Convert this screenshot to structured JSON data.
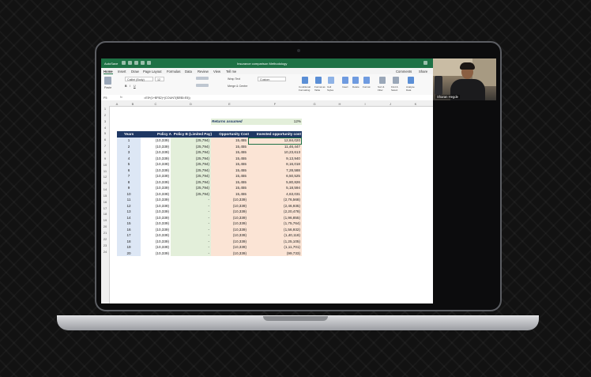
{
  "window": {
    "autosave": "AutoSave",
    "title": "Insurance comparison Methodology"
  },
  "menu": [
    "Home",
    "Insert",
    "Draw",
    "Page Layout",
    "Formulas",
    "Data",
    "Review",
    "View",
    "Tell me"
  ],
  "ribbon": {
    "font_name": "Calibri (Body)",
    "font_size": "12",
    "wrap_text": "Wrap Text",
    "merge_center": "Merge & Centre",
    "number_format": "Custom",
    "conditional_formatting": "Conditional Formatting",
    "format_as_table": "Format as Table",
    "cell_styles": "Cell Styles",
    "insert": "Insert",
    "delete": "Delete",
    "format": "Format",
    "sort_filter": "Sort & Filter",
    "find_select": "Find & Select",
    "analyse_data": "Analyse Data",
    "comments": "Comments",
    "share": "Share",
    "paste": "Paste"
  },
  "formula_bar": {
    "cell_ref": "F5",
    "formula": "=E5*(1+$F$2)^(COUNT($E$5:E5))"
  },
  "columns": [
    "A",
    "B",
    "C",
    "D",
    "E",
    "F",
    "G",
    "H",
    "I",
    "J",
    "K"
  ],
  "rows": [
    "1",
    "2",
    "3",
    "4",
    "5",
    "6",
    "7",
    "8",
    "9",
    "10",
    "11",
    "12",
    "13",
    "14",
    "15",
    "16",
    "17",
    "18",
    "19",
    "20",
    "21",
    "22",
    "23",
    "24"
  ],
  "sheet": {
    "returns_label": "Returns assumed",
    "returns_value": "12%",
    "headers": [
      "Years",
      "Policy A",
      "Policy B (Limited Pay)",
      "Opportunity Cost",
      "Invested opportunity cost"
    ],
    "table": [
      [
        "1",
        "(10,339)",
        "(25,794)",
        "15,455",
        "12,84,020"
      ],
      [
        "2",
        "(10,339)",
        "(25,794)",
        "15,455",
        "11,46,447"
      ],
      [
        "3",
        "(10,339)",
        "(25,794)",
        "15,455",
        "10,23,613"
      ],
      [
        "4",
        "(10,339)",
        "(25,794)",
        "15,455",
        "9,13,940"
      ],
      [
        "5",
        "(10,339)",
        "(25,794)",
        "15,455",
        "8,16,018"
      ],
      [
        "6",
        "(10,339)",
        "(25,794)",
        "15,455",
        "7,28,588"
      ],
      [
        "7",
        "(10,339)",
        "(25,794)",
        "15,455",
        "6,50,525"
      ],
      [
        "8",
        "(10,339)",
        "(25,794)",
        "15,455",
        "5,80,826"
      ],
      [
        "9",
        "(10,339)",
        "(25,794)",
        "15,455",
        "5,18,594"
      ],
      [
        "10",
        "(10,339)",
        "(25,794)",
        "15,455",
        "4,63,031"
      ],
      [
        "11",
        "(10,339)",
        "-",
        "(10,339)",
        "(2,76,568)"
      ],
      [
        "12",
        "(10,339)",
        "-",
        "(10,339)",
        "(2,46,935)"
      ],
      [
        "13",
        "(10,339)",
        "-",
        "(10,339)",
        "(2,20,478)"
      ],
      [
        "14",
        "(10,339)",
        "-",
        "(10,339)",
        "(1,96,855)"
      ],
      [
        "15",
        "(10,339)",
        "-",
        "(10,339)",
        "(1,75,764)"
      ],
      [
        "16",
        "(10,339)",
        "-",
        "(10,339)",
        "(1,56,932)"
      ],
      [
        "17",
        "(10,339)",
        "-",
        "(10,339)",
        "(1,40,118)"
      ],
      [
        "18",
        "(10,339)",
        "-",
        "(10,339)",
        "(1,25,105)"
      ],
      [
        "19",
        "(10,339)",
        "-",
        "(10,339)",
        "(1,11,701)"
      ],
      [
        "20",
        "(10,339)",
        "-",
        "(10,339)",
        "(99,733)"
      ]
    ]
  },
  "webcam": {
    "name": "Sharan Hegde"
  },
  "colors": {
    "excel_green": "#1e7145",
    "header_navy": "#1f3864"
  }
}
